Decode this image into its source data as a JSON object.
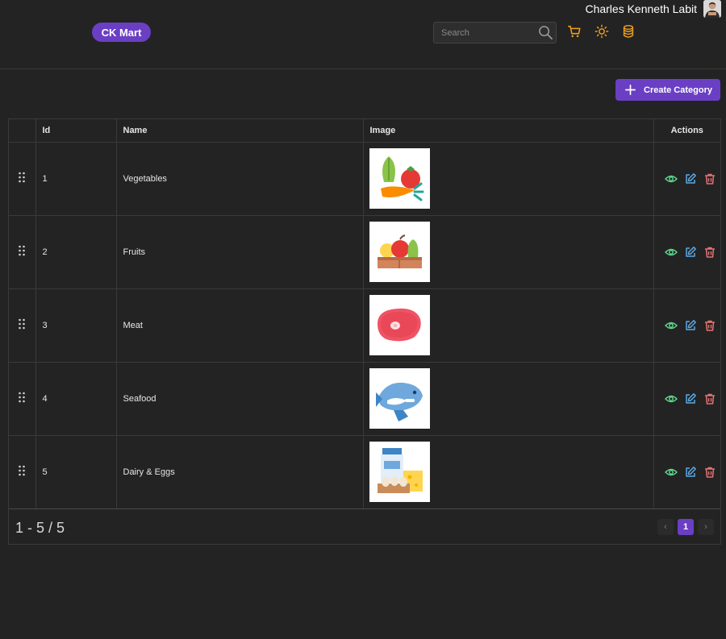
{
  "header": {
    "user_name": "Charles Kenneth Labit",
    "brand": "CK Mart",
    "search_placeholder": "Search",
    "accent_color": "#f0a020",
    "icons": [
      "cart-icon",
      "sun-icon",
      "database-icon"
    ]
  },
  "toolbar": {
    "create_label": "Create Category"
  },
  "table": {
    "columns": [
      "",
      "Id",
      "Name",
      "Image",
      "Actions"
    ],
    "rows": [
      {
        "id": "1",
        "name": "Vegetables",
        "image": "vegetables-image"
      },
      {
        "id": "2",
        "name": "Fruits",
        "image": "fruits-image"
      },
      {
        "id": "3",
        "name": "Meat",
        "image": "meat-image"
      },
      {
        "id": "4",
        "name": "Seafood",
        "image": "seafood-image"
      },
      {
        "id": "5",
        "name": "Dairy & Eggs",
        "image": "dairy-eggs-image"
      }
    ]
  },
  "pagination": {
    "range": "1 - 5 / 5",
    "prev": "‹",
    "current": "1",
    "next": "›"
  },
  "colors": {
    "primary": "#6a3fc4",
    "view": "#5fd38d",
    "edit": "#5aa9e6",
    "delete": "#e57373",
    "background": "#232323"
  }
}
